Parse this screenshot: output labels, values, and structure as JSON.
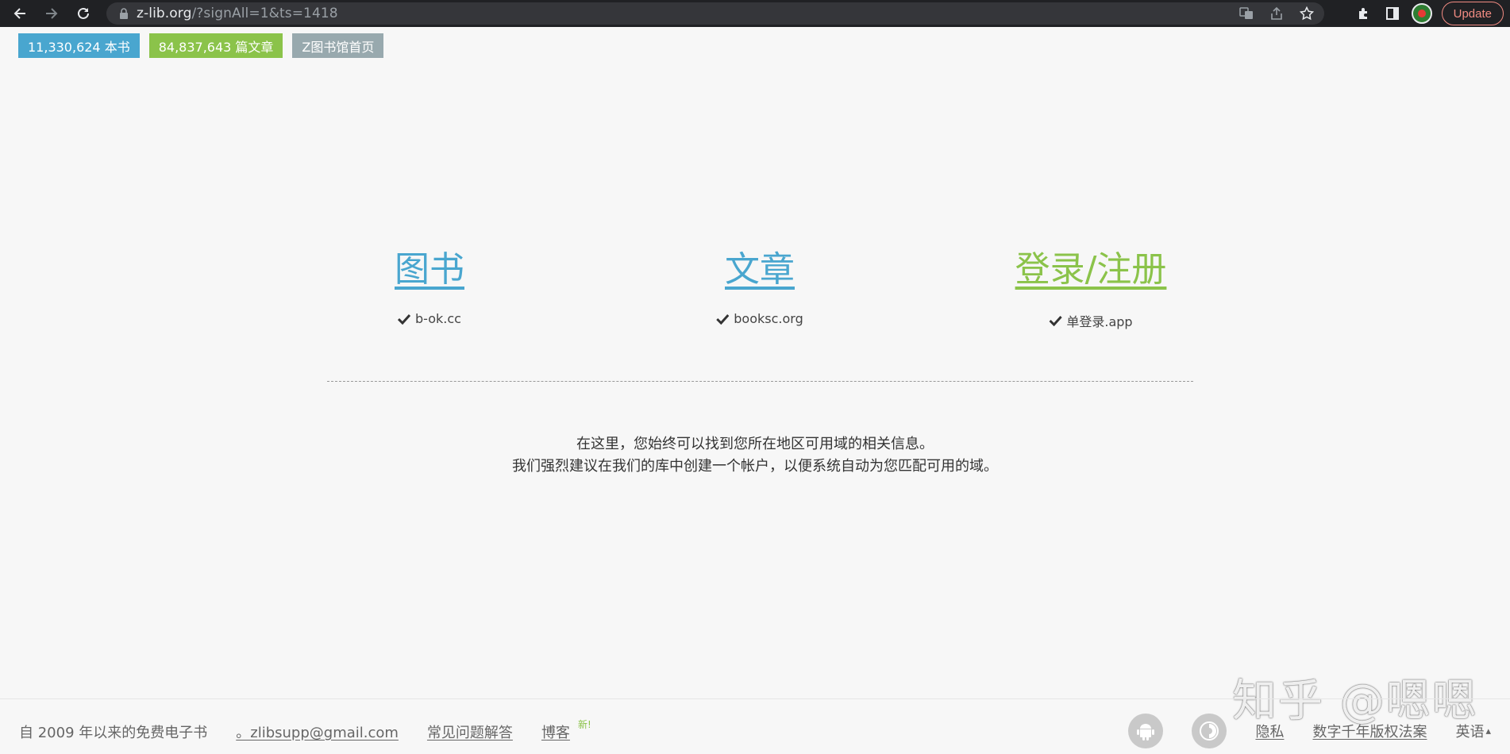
{
  "browser": {
    "url_host": "z-lib.org",
    "url_rest": "/?signAll=1&ts=1418",
    "update_label": "Update",
    "icons": [
      "back-icon",
      "forward-icon",
      "reload-icon",
      "lock-icon",
      "translate-icon",
      "share-icon",
      "star-icon",
      "puzzle-icon",
      "side-panel-icon",
      "avatar"
    ]
  },
  "stats": {
    "books": "11,330,624 本书",
    "articles": "84,837,643 篇文章",
    "home": "Z图书馆首页"
  },
  "domains": {
    "books": {
      "title": "图书",
      "domain": "b-ok.cc"
    },
    "articles": {
      "title": "文章",
      "domain": "booksc.org"
    },
    "login": {
      "title": "登录/注册",
      "domain": "单登录.app"
    }
  },
  "info": {
    "line1": "在这里，您始终可以找到您所在地区可用域的相关信息。",
    "line2": "我们强烈建议在我们的库中创建一个帐户，以便系统自动为您匹配可用的域。"
  },
  "watermark": "知乎 @嗯嗯",
  "footer": {
    "since": "自 2009 年以来的免费电子书",
    "email": "。zlibsupp@gmail.com",
    "faq": "常见问题解答",
    "blog": "博客",
    "new_tag": "新!",
    "privacy": "隐私",
    "dmca": "数字千年版权法案",
    "language": "英语",
    "language_caret": "▴"
  },
  "colors": {
    "blue": "#49a6cf",
    "green": "#8bc34a",
    "gray": "#98a9ae",
    "background": "#f7f7f7"
  }
}
